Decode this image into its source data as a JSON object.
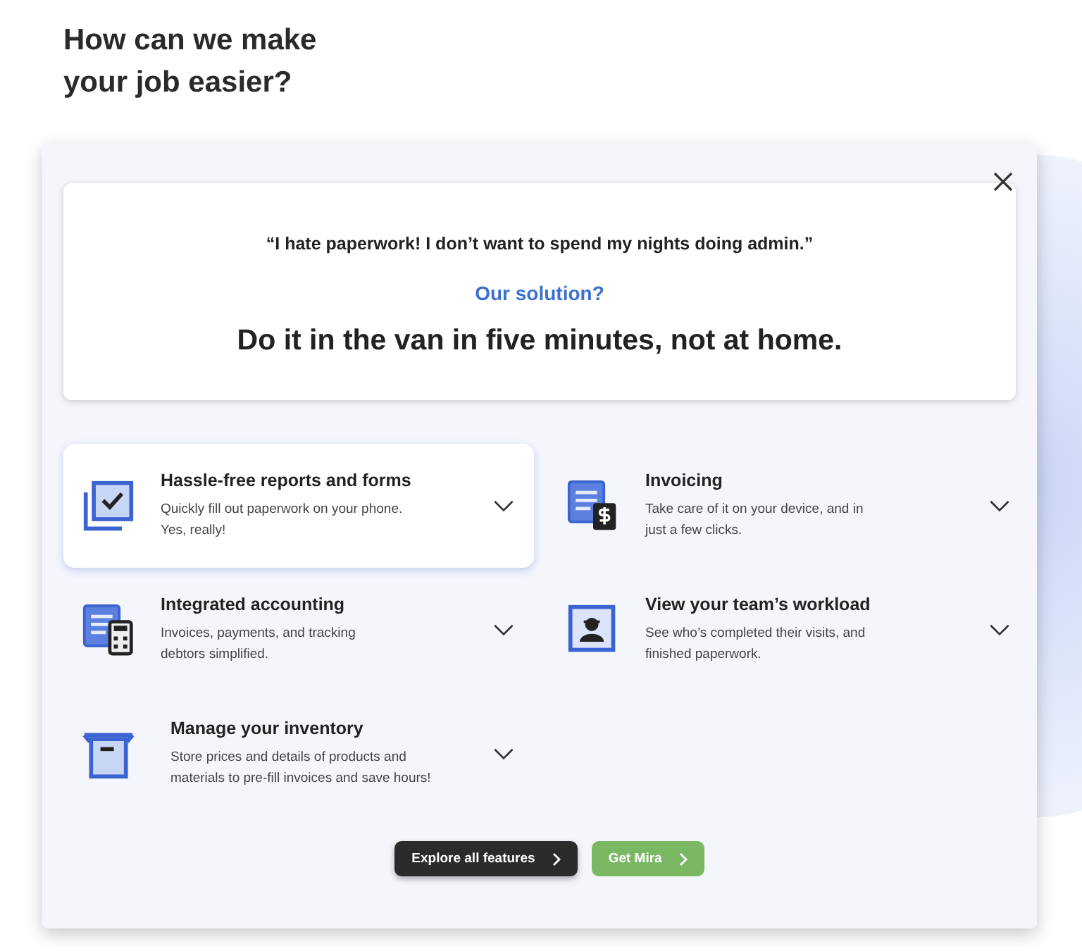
{
  "heading": [
    "How can we make",
    "your job easier?"
  ],
  "modal": {
    "quote": "“I hate paperwork! I don’t want to spend my nights doing admin.”",
    "solution_label": "Our solution?",
    "solution": "Do it in the van in five minutes, not at home.",
    "features": [
      {
        "kind": "forms",
        "title": "Hassle-free reports and forms",
        "text": "Quickly fill out paperwork on your phone. Yes, really!",
        "selected": true,
        "expanded": false
      },
      {
        "kind": "invoice",
        "title": "Invoicing",
        "text": "Take care of it on your device, and in just a few clicks.",
        "selected": false,
        "expanded": false
      },
      {
        "kind": "accounting",
        "title": "Integrated accounting",
        "text": "Invoices, payments, and tracking debtors simplified.",
        "selected": false,
        "expanded": false
      },
      {
        "kind": "team",
        "title": "View your team’s workload",
        "text": "See who’s completed their visits, and finished paperwork.",
        "selected": false,
        "expanded": false
      },
      {
        "kind": "inventory",
        "title": "Manage your inventory",
        "text": "Store prices and details of products and materials to pre-fill invoices and save hours!",
        "selected": false,
        "expanded": false
      }
    ],
    "buttons": [
      {
        "kind": "dark",
        "label": "Explore all features"
      },
      {
        "kind": "green",
        "label": "Get Mira"
      }
    ]
  }
}
